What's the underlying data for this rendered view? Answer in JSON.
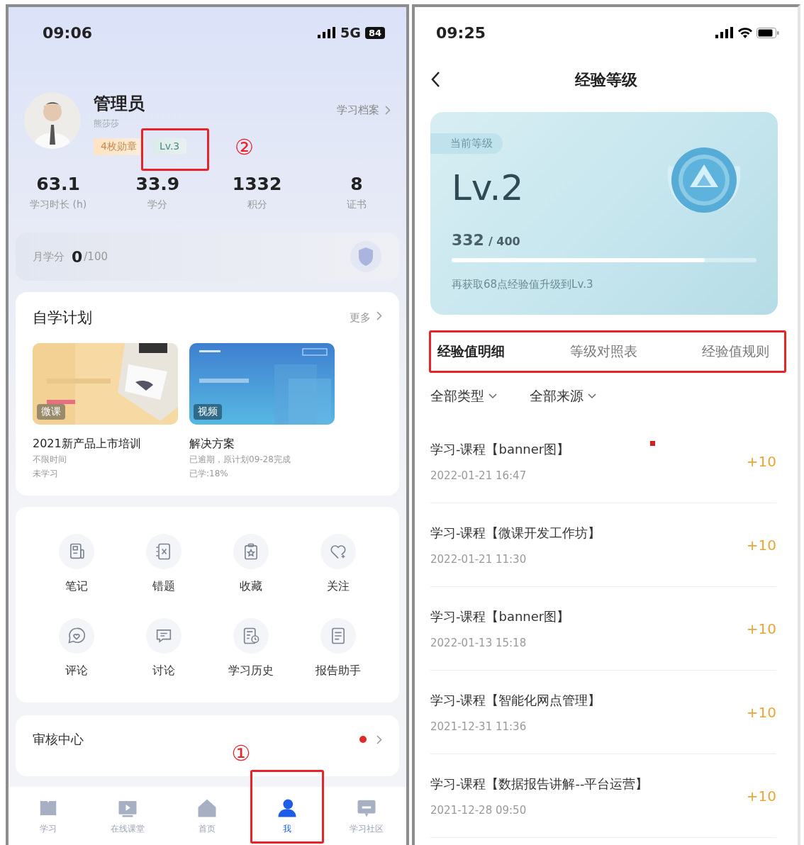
{
  "profile_screen": {
    "status_bar": {
      "time": "09:06",
      "network": "5G",
      "battery": "84"
    },
    "profile": {
      "name": "管理员",
      "subtitle": "熊莎莎",
      "archive_link": "学习档案",
      "badges": [
        {
          "text": "4枚勋章",
          "kind": "medal",
          "highlighted": false
        },
        {
          "text": "Lv.3",
          "kind": "level",
          "highlighted": true,
          "callout": "②"
        }
      ]
    },
    "stats": [
      {
        "value": "63.1",
        "label": "学习时长 (h)"
      },
      {
        "value": "33.9",
        "label": "学分"
      },
      {
        "value": "1332",
        "label": "积分"
      },
      {
        "value": "8",
        "label": "证书"
      }
    ],
    "monthly_credit": {
      "label": "月学分",
      "value": "0",
      "total": "/100"
    },
    "self_study": {
      "title": "自学计划",
      "more": "更多",
      "courses": [
        {
          "badge": "微课",
          "title": "2021新产品上市培训",
          "lines": [
            "不限时间",
            "未学习"
          ]
        },
        {
          "badge": "视频",
          "title": "解决方案",
          "lines": [
            "已逾期，原计划09-28完成",
            "已学:18%"
          ]
        }
      ]
    },
    "shortcuts": [
      {
        "label": "笔记"
      },
      {
        "label": "错题"
      },
      {
        "label": "收藏"
      },
      {
        "label": "关注"
      },
      {
        "label": "评论"
      },
      {
        "label": "讨论"
      },
      {
        "label": "学习历史"
      },
      {
        "label": "报告助手"
      }
    ],
    "review_center": {
      "title": "审核中心",
      "unread": true
    },
    "tab_bar": [
      {
        "label": "学习",
        "selected": false,
        "highlighted": false
      },
      {
        "label": "在线课堂",
        "selected": false,
        "highlighted": false
      },
      {
        "label": "首页",
        "selected": false,
        "highlighted": false
      },
      {
        "label": "我",
        "selected": true,
        "highlighted": true,
        "callout": "①"
      },
      {
        "label": "学习社区",
        "selected": false,
        "highlighted": false
      }
    ]
  },
  "level_screen": {
    "status_bar": {
      "time": "09:25"
    },
    "title": "经验等级",
    "level_card": {
      "tag": "当前等级",
      "level_name": "Lv.2",
      "points": "332",
      "total": "/ 400",
      "level": 0.83,
      "hint": "再获取68点经验值升级到Lv.3"
    },
    "tabs_highlighted": true,
    "tabs": [
      {
        "label": "经验值明细",
        "selected": true
      },
      {
        "label": "等级对照表",
        "selected": false
      },
      {
        "label": "经验值规则",
        "selected": false
      }
    ],
    "filters": [
      "全部类型",
      "全部来源"
    ],
    "records": [
      {
        "title": "学习-课程【banner图】",
        "time": "2022-01-21 16:47",
        "points": "+10"
      },
      {
        "title": "学习-课程【微课开发工作坊】",
        "time": "2022-01-21 11:30",
        "points": "+10"
      },
      {
        "title": "学习-课程【banner图】",
        "time": "2022-01-13 15:18",
        "points": "+10"
      },
      {
        "title": "学习-课程【智能化网点管理】",
        "time": "2021-12-31 11:36",
        "points": "+10"
      },
      {
        "title": "学习-课程【数据报告讲解--平台运营】",
        "time": "2021-12-28 09:50",
        "points": "+10"
      }
    ]
  }
}
